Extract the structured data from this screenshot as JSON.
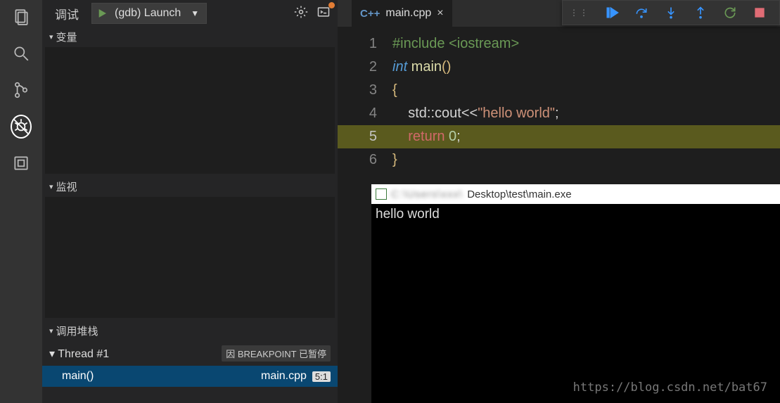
{
  "side": {
    "title": "调试",
    "launch_config": "(gdb) Launch"
  },
  "sections": {
    "variables": "变量",
    "watch": "监视",
    "callstack": "调用堆栈"
  },
  "callstack": {
    "thread": "Thread #1",
    "thread_state": "因 BREAKPOINT 已暂停",
    "frame_fn": "main()",
    "frame_file": "main.cpp",
    "frame_pos": "5:1"
  },
  "tab": {
    "icon_label": "C++",
    "filename": "main.cpp"
  },
  "code": {
    "lines": [
      "1",
      "2",
      "3",
      "4",
      "5",
      "6"
    ],
    "l1_include": "#include",
    "l1_header": "<iostream>",
    "l2_int": "int",
    "l2_main": " main",
    "l2_paren": "()",
    "l3_brace": "{",
    "l4_pre": "    std",
    "l4_colon": "::",
    "l4_cout": "cout",
    "l4_op": "<<",
    "l4_str": "\"hello world\"",
    "l4_semi": ";",
    "l5_indent": "    ",
    "l5_return": "return",
    "l5_sp": " ",
    "l5_zero": "0",
    "l5_semi": ";",
    "l6_brace": "}"
  },
  "terminal": {
    "title_path": "Desktop\\test\\main.exe",
    "output": "hello world"
  },
  "watermark": "https://blog.csdn.net/bat67"
}
